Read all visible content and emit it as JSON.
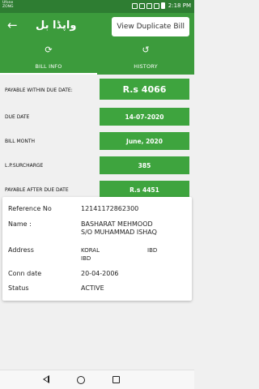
{
  "status_bar": {
    "carrier_line1": "Ufone",
    "carrier_line2": "ZONG",
    "time": "2:18 PM"
  },
  "app_bar": {
    "title": "واپڈا بل",
    "back_icon": "arrow-left-icon",
    "view_duplicate_label": "View Duplicate Bill"
  },
  "tabs": [
    {
      "label": "BILL INFO",
      "icon": "refresh-icon",
      "active": true
    },
    {
      "label": "HISTORY",
      "icon": "history-icon",
      "active": false
    }
  ],
  "bill_rows": [
    {
      "label": "PAYABLE WITHIN DUE DATE:",
      "value": "R.s 4066"
    },
    {
      "label": "DUE DATE",
      "value": "14-07-2020"
    },
    {
      "label": "BILL MONTH",
      "value": "June, 2020"
    },
    {
      "label": "L.P.SURCHARGE",
      "value": "385"
    },
    {
      "label": "PAYABLE AFTER DUE DATE",
      "value": "R.s 4451"
    }
  ],
  "details": {
    "reference_no_label": "Reference No",
    "reference_no": "12141172862300",
    "name_label": "Name :",
    "name_line1": "BASHARAT MEHMOOD",
    "name_line2": "S/O MUHAMMAD ISHAQ",
    "address_label": "Address",
    "address_line1": "KORAL",
    "address_line2": "IBD",
    "address_extra": "IBD",
    "conn_date_label": "Conn date",
    "conn_date": "20-04-2006",
    "status_label": "Status",
    "status": "ACTIVE"
  },
  "colors": {
    "primary": "#3c9b3c",
    "status_bar": "#2e7d32",
    "value_bg": "#3ea43e"
  }
}
